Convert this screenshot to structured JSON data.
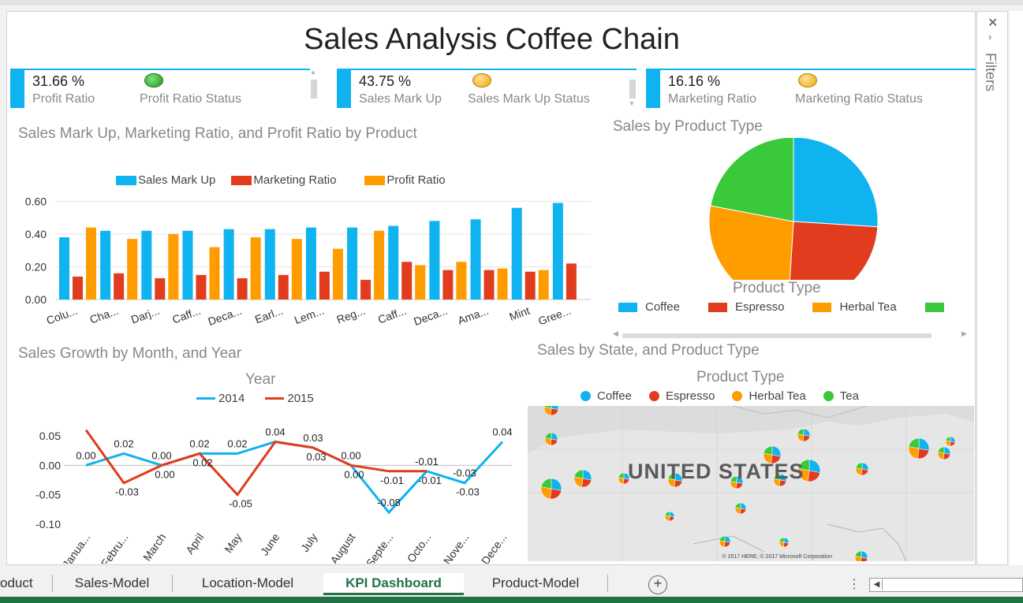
{
  "dashboard": {
    "title": "Sales Analysis Coffee Chain",
    "kpis": [
      {
        "value": "31.66 %",
        "caption": "Profit Ratio",
        "status_caption": "Profit Ratio Status",
        "status_color": "#2da52d"
      },
      {
        "value": "43.75 %",
        "caption": "Sales Mark Up",
        "status_caption": "Sales Mark Up Status",
        "status_color": "#f0a900"
      },
      {
        "value": "16.16 %",
        "caption": "Marketing Ratio",
        "status_caption": "Marketing Ratio Status",
        "status_color": "#f0a900"
      }
    ]
  },
  "filters_pane": {
    "label": "Filters",
    "close_icon": "close-icon",
    "collapse_icon": "chevron-right-icon"
  },
  "bar_chart_panel": {
    "title": "Sales Mark Up, Marketing Ratio, and Profit Ratio by Product",
    "legend": [
      "Sales Mark Up",
      "Marketing Ratio",
      "Profit Ratio"
    ]
  },
  "pie_panel": {
    "title": "Sales by Product Type",
    "legend_title": "Product Type",
    "legend": [
      "Coffee",
      "Espresso",
      "Herbal Tea"
    ]
  },
  "line_panel": {
    "title": "Sales Growth by Month, and Year",
    "legend_title": "Year",
    "legend": [
      "2014",
      "2015"
    ]
  },
  "map_panel": {
    "title": "Sales by State, and Product Type",
    "legend_title": "Product Type",
    "legend": [
      "Coffee",
      "Espresso",
      "Herbal Tea",
      "Tea"
    ],
    "country_label": "UNITED STATES",
    "credit": "© 2017 HERE, © 2017 Microsoft Corporation"
  },
  "sheet_tabs": [
    {
      "label": "oduct",
      "active": false
    },
    {
      "label": "Sales-Model",
      "active": false
    },
    {
      "label": "Location-Model",
      "active": false
    },
    {
      "label": "KPI Dashboard",
      "active": true
    },
    {
      "label": "Product-Model",
      "active": false
    }
  ],
  "colors": {
    "blue": "#0fb3ef",
    "red": "#e03c1d",
    "orange": "#ff9c00",
    "green": "#3ac93a",
    "excel_green": "#217346"
  },
  "chart_data": [
    {
      "type": "bar",
      "title": "Sales Mark Up, Marketing Ratio, and Profit Ratio by Product",
      "categories": [
        "Colu...",
        "Cha...",
        "Darj...",
        "Caff...",
        "Deca...",
        "Earl...",
        "Lem...",
        "Reg...",
        "Caff...",
        "Deca...",
        "Ama...",
        "Mint",
        "Gree..."
      ],
      "series": [
        {
          "name": "Sales Mark Up",
          "values": [
            0.38,
            0.42,
            0.42,
            0.42,
            0.43,
            0.43,
            0.44,
            0.44,
            0.45,
            0.48,
            0.49,
            0.56,
            0.59
          ]
        },
        {
          "name": "Marketing Ratio",
          "values": [
            0.14,
            0.16,
            0.13,
            0.15,
            0.13,
            0.15,
            0.17,
            0.12,
            0.23,
            0.18,
            0.18,
            0.17,
            0.22
          ]
        },
        {
          "name": "Profit Ratio",
          "values": [
            0.44,
            0.37,
            0.4,
            0.32,
            0.38,
            0.37,
            0.31,
            0.42,
            0.21,
            0.23,
            0.19,
            0.18,
            null
          ]
        }
      ],
      "yticks": [
        "0.00",
        "0.20",
        "0.40",
        "0.60"
      ],
      "ylim": [
        0,
        0.65
      ],
      "legend_position": "top"
    },
    {
      "type": "pie",
      "title": "Sales by Product Type",
      "legend_title": "Product Type",
      "labels": [
        "Coffee",
        "Espresso",
        "Herbal Tea",
        "Tea"
      ],
      "values": [
        26,
        25,
        27,
        22
      ]
    },
    {
      "type": "line",
      "title": "Sales Growth by Month, and Year",
      "legend_title": "Year",
      "categories": [
        "Janua...",
        "Febru...",
        "March",
        "April",
        "May",
        "June",
        "July",
        "August",
        "Septe...",
        "Octo...",
        "Nove...",
        "Dece..."
      ],
      "series": [
        {
          "name": "2014",
          "values": [
            0.0,
            0.02,
            0.0,
            0.02,
            0.02,
            0.04,
            0.03,
            0.0,
            -0.08,
            -0.01,
            -0.03,
            0.04
          ]
        },
        {
          "name": "2015",
          "values": [
            0.06,
            -0.03,
            0.0,
            0.02,
            -0.05,
            0.04,
            0.03,
            0.0,
            -0.01,
            -0.01,
            null,
            null
          ]
        }
      ],
      "labels_2014": [
        "0.00",
        "0.02",
        "0.00",
        "0.02",
        "0.02",
        "0.04",
        "0.03",
        "0.00",
        "-0.08",
        "-0.01",
        "-0.03",
        "0.04"
      ],
      "labels_2015": [
        "",
        "-0.03",
        "0.00",
        "0.02",
        "-0.05",
        "",
        "0.03",
        "0.00",
        "-0.01",
        "-0.01",
        "-0.03",
        ""
      ],
      "yticks": [
        "-0.10",
        "-0.05",
        "0.00",
        "0.05"
      ],
      "ylim": [
        -0.1,
        0.06
      ]
    }
  ]
}
